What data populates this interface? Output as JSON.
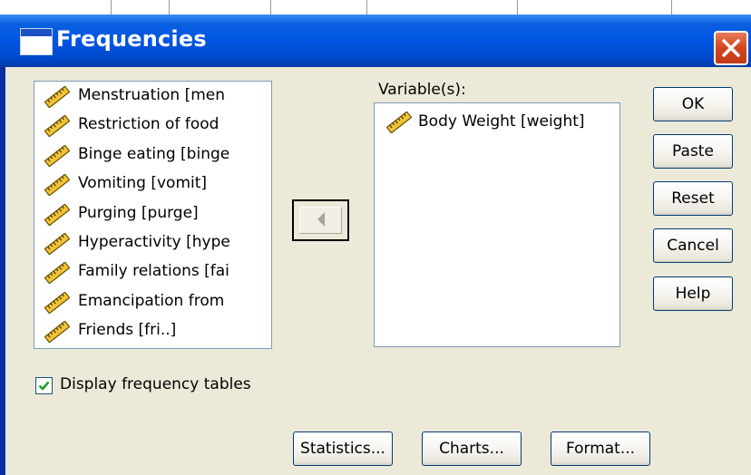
{
  "dialog": {
    "title": "Frequencies"
  },
  "source_list": {
    "items": [
      {
        "label": "Menstruation [men"
      },
      {
        "label": "Restriction of food"
      },
      {
        "label": "Binge eating [binge"
      },
      {
        "label": "Vomiting [vomit]"
      },
      {
        "label": "Purging [purge]"
      },
      {
        "label": "Hyperactivity [hype"
      },
      {
        "label": "Family relations [fai"
      },
      {
        "label": "Emancipation from"
      },
      {
        "label": "Friends [fri..]"
      }
    ],
    "item_icon": "scale-ruler-icon"
  },
  "variables": {
    "label": "Variable(s):",
    "items": [
      {
        "label": "Body Weight [weight]"
      }
    ]
  },
  "buttons": {
    "ok": "OK",
    "paste": "Paste",
    "reset": "Reset",
    "cancel": "Cancel",
    "help": "Help",
    "statistics": "Statistics...",
    "charts": "Charts...",
    "format": "Format..."
  },
  "checkbox": {
    "label": "Display frequency tables",
    "checked": true
  },
  "colors": {
    "titlebar": "#0055e5",
    "close": "#d3461f",
    "face": "#ece9d8"
  }
}
